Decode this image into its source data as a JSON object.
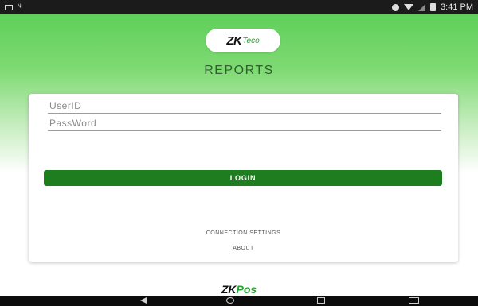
{
  "status_bar": {
    "time": "3:41 PM",
    "left_icons": [
      "sheet-icon",
      "signal-icon"
    ],
    "right_icons": [
      "circle-icon",
      "wifi-icon",
      "cell-signal-icon",
      "battery-icon"
    ]
  },
  "header": {
    "logo_main": "ZK",
    "logo_sub": "Teco",
    "title": "REPORTS"
  },
  "form": {
    "user_placeholder": "UserID",
    "password_placeholder": "PassWord",
    "login_label": "LOGIN"
  },
  "links": {
    "connection_settings": "CONNECTION SETTINGS",
    "about": "ABOUT"
  },
  "footer_brand": {
    "main": "ZK",
    "sub": "Pos"
  },
  "nav_bar": {
    "icons": [
      "back-icon",
      "home-icon",
      "recents-icon",
      "keyboard-icon"
    ]
  },
  "colors": {
    "accent": "#1e7d1e",
    "header_green": "#5fcf5a"
  }
}
